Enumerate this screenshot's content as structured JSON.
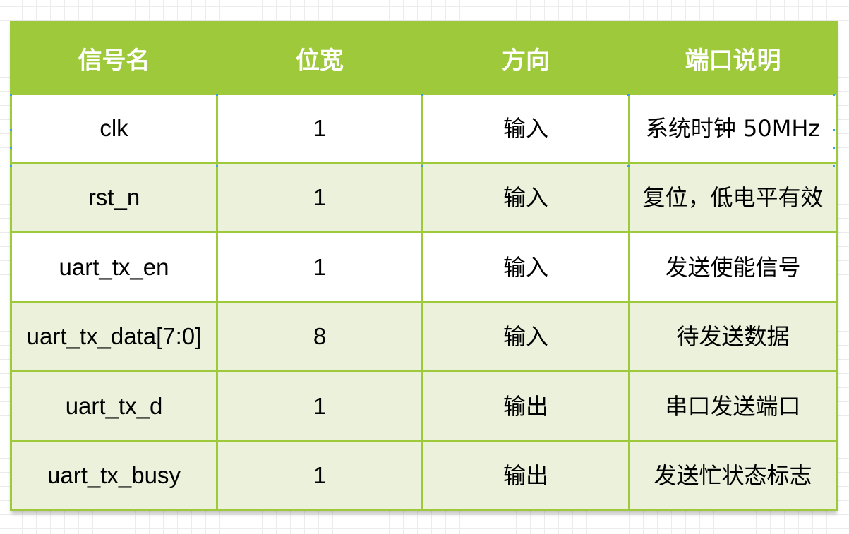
{
  "table": {
    "headers": [
      "信号名",
      "位宽",
      "方向",
      "端口说明"
    ],
    "rows": [
      [
        "clk",
        "1",
        "输入",
        "系统时钟 50MHz"
      ],
      [
        "rst_n",
        "1",
        "输入",
        "复位，低电平有效"
      ],
      [
        "uart_tx_en",
        "1",
        "输入",
        "发送使能信号"
      ],
      [
        "uart_tx_data[7:0]",
        "8",
        "输入",
        "待发送数据"
      ],
      [
        "uart_tx_d",
        "1",
        "输出",
        "串口发送端口"
      ],
      [
        "uart_tx_busy",
        "1",
        "输出",
        "发送忙状态标志"
      ]
    ]
  },
  "colors": {
    "header_bg": "#9dc93a",
    "border": "#9dc93a",
    "alt_row_bg": "#ebf1da",
    "row_bg": "#ffffff",
    "selection_handle": "#3aa0e0"
  }
}
